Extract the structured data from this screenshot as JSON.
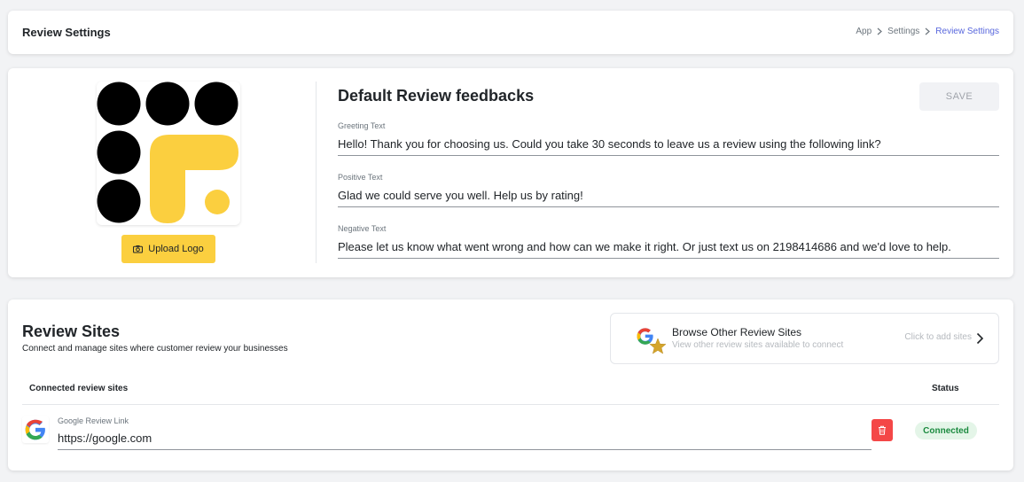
{
  "header": {
    "title": "Review Settings",
    "breadcrumb": [
      "App",
      "Settings",
      "Review Settings"
    ]
  },
  "feedback": {
    "upload_logo_label": "Upload Logo",
    "title": "Default Review feedbacks",
    "save_label": "SAVE",
    "fields": [
      {
        "label": "Greeting Text",
        "value": "Hello! Thank you for choosing us. Could you take 30 seconds to leave us a review using the following link?"
      },
      {
        "label": "Positive Text",
        "value": "Glad we could serve you well. Help us by rating!"
      },
      {
        "label": "Negative Text",
        "value": "Please let us know what went wrong and how can we make it right. Or just text us on 2198414686 and we'd love to help."
      }
    ]
  },
  "review_sites": {
    "title": "Review Sites",
    "subtitle": "Connect and manage sites where customer review your businesses",
    "browse": {
      "title": "Browse Other Review Sites",
      "subtitle": "View other review sites available to connect",
      "cta": "Click to add sites"
    },
    "columns": {
      "connected": "Connected review sites",
      "status": "Status"
    },
    "sites": [
      {
        "label": "Google Review Link",
        "value": "https://google.com",
        "status": "Connected"
      }
    ]
  },
  "icons": {
    "camera": "camera-icon",
    "chevron": "chevron-right-icon",
    "trash": "trash-icon",
    "google": "google-icon",
    "star": "star-icon"
  },
  "colors": {
    "accent_yellow": "#fbcf3f",
    "breadcrumb_active": "#5867dd",
    "danger": "#f44747",
    "success_text": "#1b8a3f",
    "success_bg": "#e4f5e8"
  }
}
